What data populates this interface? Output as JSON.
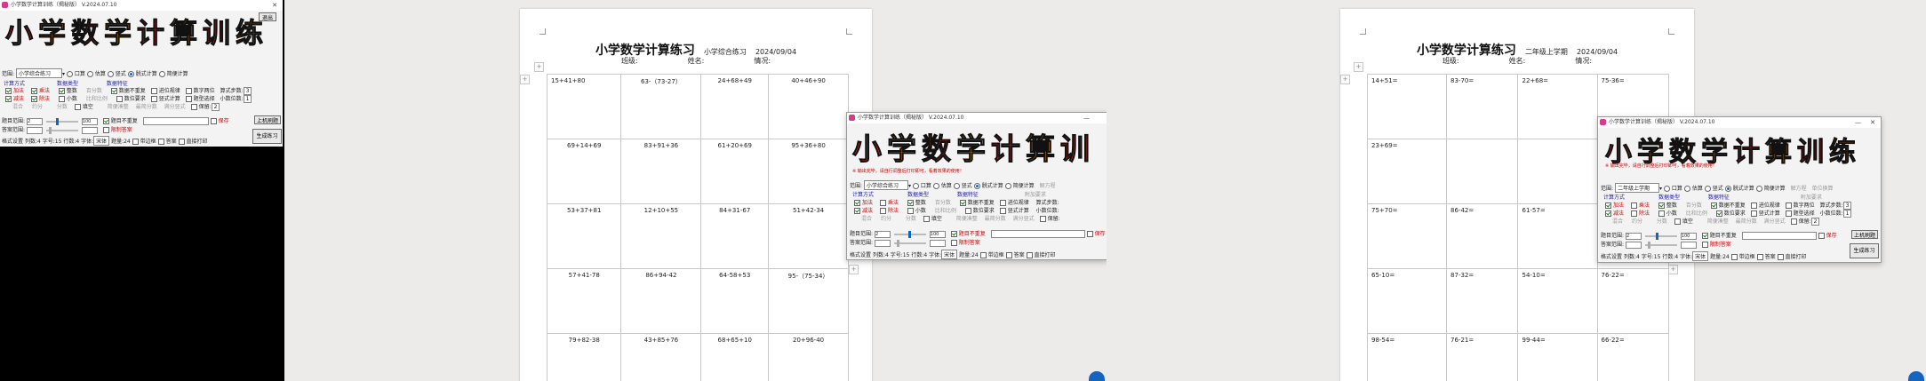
{
  "app": {
    "window_title": "小学数学计算训练（揭秘版） V.2024.07.10",
    "banner_chars": [
      "小",
      "学",
      "数",
      "学",
      "计",
      "算",
      "训",
      "练"
    ],
    "exit_label": "退出",
    "hint_text": "※ 输出完毕，请自行调整后打印即可，看着效果的使用！",
    "range_label": "范围:",
    "range_value_left": "小学综合练习",
    "range_value_right": "二年级上学期",
    "modes": [
      "口算",
      "估算",
      "竖式",
      "脱式计算",
      "简便计算"
    ],
    "mode_right_extra": [
      "解方程",
      "单位换算"
    ],
    "group_calc": "计算方式",
    "calc_ops": [
      "加法",
      "乘法",
      "减法",
      "除法"
    ],
    "calc_ops2": [
      "混合",
      "约分"
    ],
    "group_num": "数据类型",
    "num_types": [
      "整数",
      "百分数",
      "小数",
      "比和比例",
      "分数",
      "填空"
    ],
    "group_feat": "数据特征",
    "features": [
      "数据不重复",
      "数位要求",
      "简便凑整",
      "进位规律",
      "竖式计算",
      "最简分数",
      "题型选择",
      "数字两位",
      "满分竖式"
    ],
    "extra_label": "附加要求",
    "extra_items": [
      {
        "label": "算式步数:",
        "value": "3"
      },
      {
        "label": "小数位数:",
        "value": "1"
      },
      {
        "label": "保留:",
        "value": "2"
      }
    ],
    "save_label": "保存",
    "range_title": "题目范围:",
    "answer_title": "答案范围:",
    "range_min": "2",
    "range_max": "100",
    "dup_label": "题目不重复",
    "limit_label": "限制答案",
    "style_label": "格式设置",
    "cols_label": "列数:",
    "cols_value": "4",
    "fontsize_label": "字号:",
    "fontsize_value": "15",
    "rows_label": "行数:",
    "rows_value": "4",
    "font_label": "字体:",
    "font_value": "宋体",
    "count_label": "题量:",
    "count_value": "24",
    "options": [
      "带边框",
      "答案",
      "直接打印"
    ],
    "build_label": "上机刷题",
    "generate_label": "生成练习"
  },
  "doc1": {
    "title": "小学数学计算练习",
    "subtitle": "小学综合练习",
    "date": "2024/09/04",
    "info": [
      "班级:",
      "姓名:",
      "情况:"
    ],
    "rows": [
      [
        "15+41+80",
        "63-（73-27）",
        "24+68+49",
        "40+46+90"
      ],
      [
        "69+14+69",
        "83+91+36",
        "61+20+69",
        "95+36+80"
      ],
      [
        "53+37+81",
        "12+10+55",
        "84+31-67",
        "51+42-34"
      ],
      [
        "57+41-78",
        "86+94-42",
        "64-58+53",
        "95-（75-34）"
      ],
      [
        "79+82-38",
        "43+85+76",
        "68+65+10",
        "20+96-40"
      ]
    ]
  },
  "doc2": {
    "title": "小学数学计算练习",
    "subtitle": "二年级上学期",
    "date": "2024/09/04",
    "info": [
      "班级:",
      "姓名:",
      "情况:"
    ],
    "rows": [
      [
        "14+51=",
        "83-70=",
        "22+68=",
        "75-36="
      ],
      [
        "23+69=",
        "",
        "",
        "",
        ""
      ],
      [
        "75+70=",
        "86-42=",
        "61-57=",
        ""
      ],
      [
        "65-10=",
        "87-32=",
        "54-10=",
        "76-22="
      ],
      [
        "98-54=",
        "76-21=",
        "99-44=",
        "66-22="
      ]
    ]
  }
}
